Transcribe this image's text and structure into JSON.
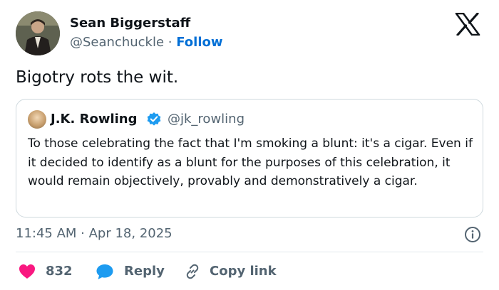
{
  "author": {
    "name": "Sean Biggerstaff",
    "handle": "@Seanchuckle",
    "separator": " · ",
    "follow_label": "Follow"
  },
  "tweet": {
    "text": "Bigotry rots the wit."
  },
  "quoted": {
    "name": "J.K. Rowling",
    "handle": "@jk_rowling",
    "text": "To those celebrating the fact that I'm smoking a blunt: it's a cigar. Even if it decided to identify as a blunt for the purposes of this celebration, it would remain objectively, provably and demonstratively a cigar."
  },
  "meta": {
    "timestamp": "11:45 AM · Apr 18, 2025"
  },
  "actions": {
    "like_count": "832",
    "reply_label": "Reply",
    "copy_label": "Copy link"
  },
  "icons": [
    "x-logo-icon",
    "verified-badge-icon",
    "info-icon",
    "heart-icon",
    "reply-bubble-icon",
    "link-icon"
  ],
  "colors": {
    "text": "#0f1419",
    "secondary": "#536471",
    "follow": "#006fd6",
    "verified": "#1d9bf0",
    "like": "#f91880",
    "border": "#cfd9de"
  }
}
